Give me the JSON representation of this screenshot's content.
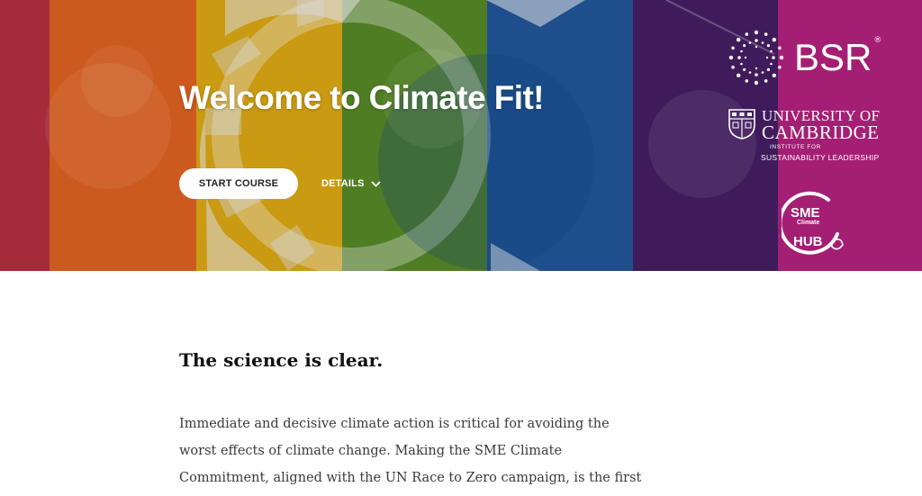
{
  "hero": {
    "title": "Welcome to Climate Fit!",
    "start_button_label": "START COURSE",
    "details_label": "DETAILS",
    "stripe_colors": [
      "#a52a3a",
      "#cc5a1e",
      "#c99a12",
      "#4f7d24",
      "#1e4f8c",
      "#3f1b5c",
      "#a41f73"
    ]
  },
  "logos": {
    "bsr": {
      "text": "BSR",
      "registered": "®",
      "icon": "sunburst-dots-icon"
    },
    "cambridge": {
      "line1": "UNIVERSITY OF",
      "line2": "CAMBRIDGE",
      "line3": "INSTITUTE FOR",
      "line4": "SUSTAINABILITY LEADERSHIP",
      "icon": "cambridge-shield-icon"
    },
    "sme": {
      "line1": "SME",
      "line2": "Climate",
      "line3": "HUB",
      "icon": "leaf-ring-icon"
    }
  },
  "content": {
    "heading": "The science is clear.",
    "body_lines": [
      "Immediate and decisive climate action is critical for avoiding the",
      "worst effects of climate change. Making the SME Climate",
      "Commitment, aligned with the UN Race to Zero campaign, is the first"
    ]
  }
}
